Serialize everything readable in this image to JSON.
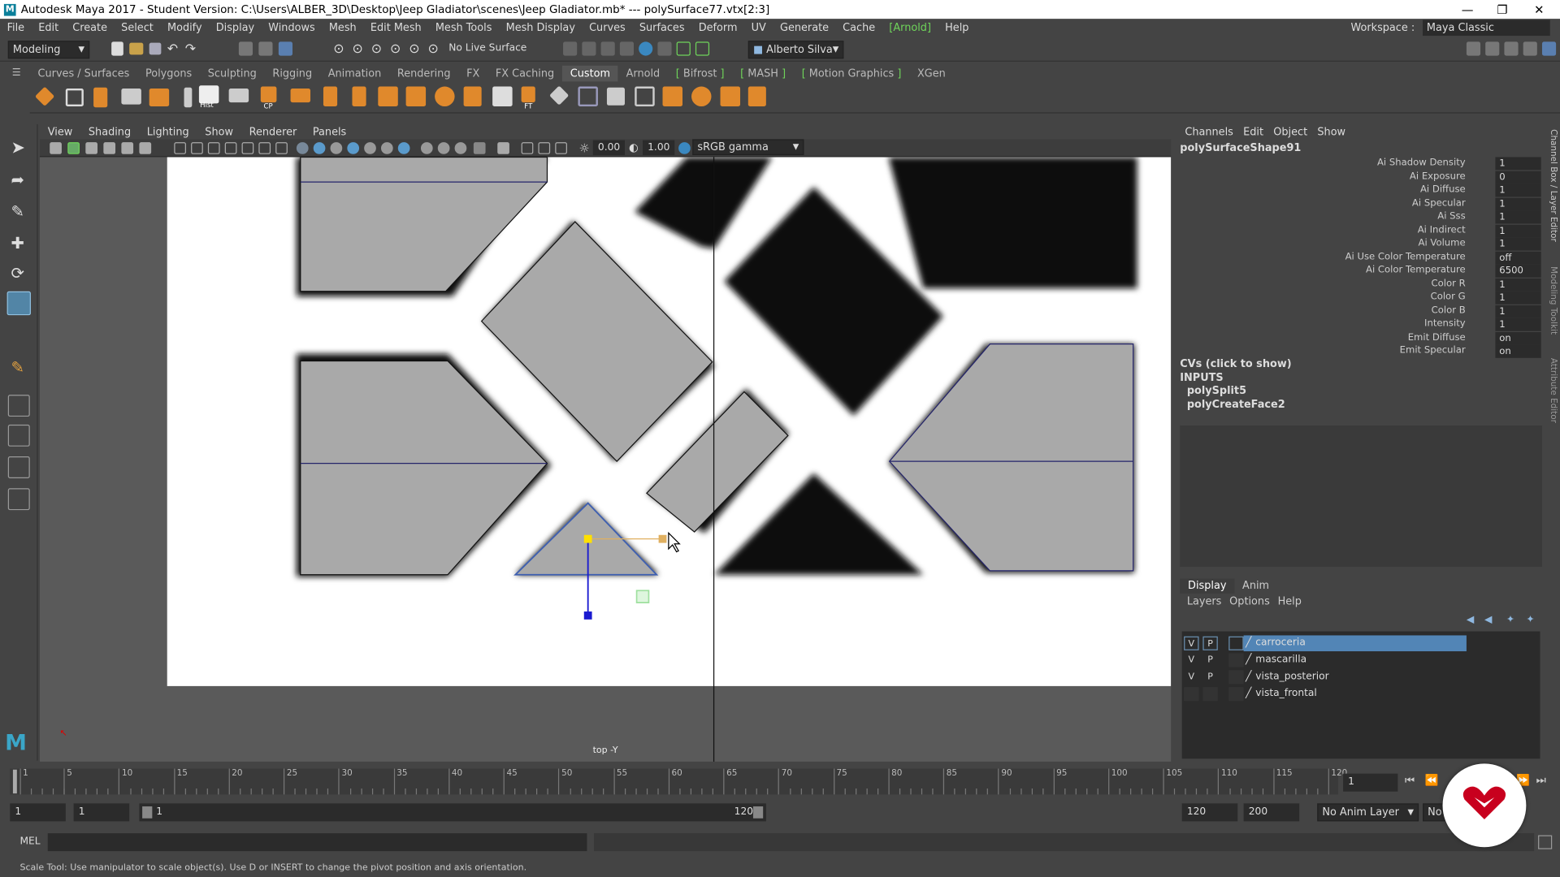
{
  "window": {
    "title": "Autodesk Maya 2017 - Student Version: C:\\Users\\ALBER_3D\\Desktop\\Jeep Gladiator\\scenes\\Jeep Gladiator.mb*   ---   polySurface77.vtx[2:3]"
  },
  "menus": [
    "File",
    "Edit",
    "Create",
    "Select",
    "Modify",
    "Display",
    "Windows",
    "Mesh",
    "Edit Mesh",
    "Mesh Tools",
    "Mesh Display",
    "Curves",
    "Surfaces",
    "Deform",
    "UV",
    "Generate",
    "Cache",
    "Arnold",
    "Help"
  ],
  "workspace": {
    "label": "Workspace :",
    "value": "Maya Classic"
  },
  "statusline": {
    "mode": "Modeling",
    "live_surface": "No Live Surface",
    "user": "Alberto Silva"
  },
  "shelf_tabs": [
    "Curves / Surfaces",
    "Polygons",
    "Sculpting",
    "Rigging",
    "Animation",
    "Rendering",
    "FX",
    "FX Caching",
    "Custom",
    "Arnold",
    "Bifrost",
    "MASH",
    "Motion Graphics",
    "XGen"
  ],
  "shelf_icon_labels": {
    "hist": "Hist",
    "cp": "CP",
    "ft": "FT"
  },
  "panel": {
    "menus": [
      "View",
      "Shading",
      "Lighting",
      "Show",
      "Renderer",
      "Panels"
    ],
    "exposure": "0.00",
    "gamma": "1.00",
    "colorspace": "sRGB gamma",
    "camera": "top -Y"
  },
  "channelbox": {
    "menus": [
      "Channels",
      "Edit",
      "Object",
      "Show"
    ],
    "node": "polySurfaceShape91",
    "attributes": [
      {
        "name": "Ai Shadow Density",
        "value": "1"
      },
      {
        "name": "Ai Exposure",
        "value": "0"
      },
      {
        "name": "Ai Diffuse",
        "value": "1"
      },
      {
        "name": "Ai Specular",
        "value": "1"
      },
      {
        "name": "Ai Sss",
        "value": "1"
      },
      {
        "name": "Ai Indirect",
        "value": "1"
      },
      {
        "name": "Ai Volume",
        "value": "1"
      },
      {
        "name": "Ai Use Color Temperature",
        "value": "off"
      },
      {
        "name": "Ai Color Temperature",
        "value": "6500"
      },
      {
        "name": "Color R",
        "value": "1"
      },
      {
        "name": "Color G",
        "value": "1"
      },
      {
        "name": "Color B",
        "value": "1"
      },
      {
        "name": "Intensity",
        "value": "1"
      },
      {
        "name": "Emit Diffuse",
        "value": "on"
      },
      {
        "name": "Emit Specular",
        "value": "on"
      }
    ],
    "cvs": "CVs (click to show)",
    "inputs_label": "INPUTS",
    "inputs": [
      "polySplit5",
      "polyCreateFace2"
    ]
  },
  "side_tabs": [
    "Channel Box / Layer Editor",
    "Modeling Toolkit",
    "Attribute Editor"
  ],
  "layer_editor": {
    "tabs": [
      "Display",
      "Anim"
    ],
    "menus": [
      "Layers",
      "Options",
      "Help"
    ],
    "layers": [
      {
        "v": "V",
        "p": "P",
        "name": "carroceria",
        "selected": true
      },
      {
        "v": "V",
        "p": "P",
        "name": "mascarilla",
        "selected": false
      },
      {
        "v": "V",
        "p": "P",
        "name": "vista_posterior",
        "selected": false
      },
      {
        "v": "",
        "p": "",
        "name": "vista_frontal",
        "selected": false
      }
    ]
  },
  "timeline": {
    "ticks": [
      "1",
      "5",
      "10",
      "15",
      "20",
      "25",
      "30",
      "35",
      "40",
      "45",
      "50",
      "55",
      "60",
      "65",
      "70",
      "75",
      "80",
      "85",
      "90",
      "95",
      "100",
      "105",
      "110",
      "115",
      "120"
    ],
    "current_frame": "1",
    "range_start": "1",
    "playback_start": "1",
    "slider_start": "1",
    "slider_end": "120",
    "playback_end": "120",
    "range_end": "200",
    "anim_layer": "No Anim Layer",
    "char_set": "No"
  },
  "cmdline": {
    "lang": "MEL"
  },
  "helpline": "Scale Tool: Use manipulator to scale object(s). Use D or INSERT to change the pivot position and axis orientation."
}
